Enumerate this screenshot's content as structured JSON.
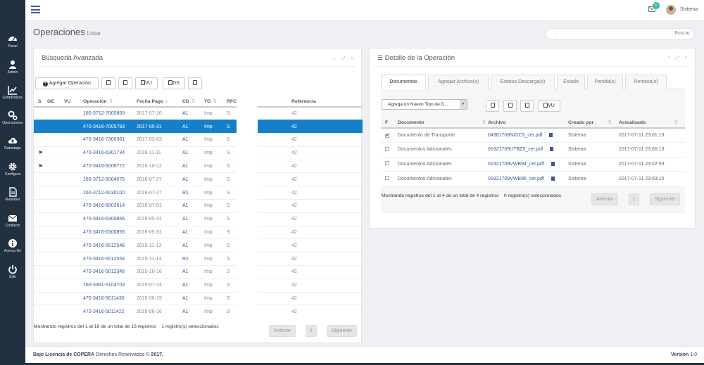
{
  "sidebar": {
    "items": [
      {
        "label": "Panel",
        "icon": "dashboard-icon"
      },
      {
        "label": "Admin",
        "icon": "users-icon"
      },
      {
        "label": "Estadísticas",
        "icon": "chart-icon"
      },
      {
        "label": "Operaciones",
        "icon": "gears-icon"
      },
      {
        "label": "Datastage",
        "icon": "cloud-upload-icon"
      },
      {
        "label": "Configura",
        "icon": "gear-icon"
      },
      {
        "label": "Reportes",
        "icon": "file-icon"
      },
      {
        "label": "Contacto",
        "icon": "envelope-icon"
      },
      {
        "label": "Acerca De",
        "icon": "info-icon"
      },
      {
        "label": "Salir",
        "icon": "power-icon"
      }
    ]
  },
  "topbar": {
    "notifications": "6",
    "user": "Sistema"
  },
  "page": {
    "title": "Operaciones",
    "subtitle": "Listar"
  },
  "search": {
    "placeholder": "...",
    "button": "Buscar"
  },
  "left_panel": {
    "title": "Búsqueda Avanzada",
    "tools": "⌄ ⤢ ×",
    "add_button": "Agregar Operación",
    "btn_vu": "VU",
    "btn_ds": "DS",
    "columns": [
      "S",
      "GE",
      "VU",
      "Operación",
      "Fecha Pago",
      "CD",
      "TO",
      "RFC",
      "Referencia"
    ],
    "rows": [
      {
        "flag": "",
        "op": "160-3712-7005669",
        "date": "2017-07-10",
        "cd": "A1",
        "to": "Imp",
        "rfc": "S",
        "ref": "42"
      },
      {
        "flag": "",
        "op": "470-3416-7005793",
        "date": "2017-05-31",
        "cd": "A1",
        "to": "Imp",
        "rfc": "S",
        "ref": "42"
      },
      {
        "flag": "",
        "op": "470-3416-7300361",
        "date": "2017-03-03",
        "cd": "A1",
        "to": "Imp",
        "rfc": "S",
        "ref": "42"
      },
      {
        "flag": "⚑",
        "op": "470-3416-6301734",
        "date": "2016-11-11",
        "cd": "A1",
        "to": "Imp",
        "rfc": "S",
        "ref": "42"
      },
      {
        "flag": "⚑",
        "op": "470-3416-6006772",
        "date": "2016-10-12",
        "cd": "A1",
        "to": "Imp",
        "rfc": "S",
        "ref": "42"
      },
      {
        "flag": "",
        "op": "160-3712-6004075",
        "date": "2016-07-27",
        "cd": "A1",
        "to": "Imp",
        "rfc": "S",
        "ref": "42"
      },
      {
        "flag": "",
        "op": "160-3712-6030100",
        "date": "2016-07-27",
        "cd": "R1",
        "to": "Imp",
        "rfc": "S",
        "ref": "42"
      },
      {
        "flag": "",
        "op": "470-3416-6003614",
        "date": "2016-07-01",
        "cd": "A1",
        "to": "Imp",
        "rfc": "S",
        "ref": "42"
      },
      {
        "flag": "",
        "op": "470-3416-6300856",
        "date": "2016-05-31",
        "cd": "A1",
        "to": "Imp",
        "rfc": "S",
        "ref": "42"
      },
      {
        "flag": "",
        "op": "470-3416-6300855",
        "date": "2016-05-31",
        "cd": "A1",
        "to": "Imp",
        "rfc": "S",
        "ref": "42"
      },
      {
        "flag": "",
        "op": "470-3416-5012548",
        "date": "2015-11-13",
        "cd": "A1",
        "to": "Imp",
        "rfc": "S",
        "ref": "42"
      },
      {
        "flag": "",
        "op": "470-3416-5012554",
        "date": "2015-11-13",
        "cd": "R1",
        "to": "Imp",
        "rfc": "S",
        "ref": "42"
      },
      {
        "flag": "",
        "op": "470-3416-5012346",
        "date": "2015-10-16",
        "cd": "A1",
        "to": "Imp",
        "rfc": "S",
        "ref": "42"
      },
      {
        "flag": "",
        "op": "160-3381-5104703",
        "date": "2015-07-24",
        "cd": "A1",
        "to": "Imp",
        "rfc": "S",
        "ref": "42"
      },
      {
        "flag": "",
        "op": "470-3416-5011430",
        "date": "2015-06-19",
        "cd": "A1",
        "to": "Imp",
        "rfc": "S",
        "ref": "42"
      },
      {
        "flag": "",
        "op": "470-3416-5011422",
        "date": "2015-06-16",
        "cd": "A1",
        "to": "Imp",
        "rfc": "S",
        "ref": "42"
      }
    ],
    "selected_row": 1,
    "info": "Mostrando registros del 1 al 16 de un total de 16 registros",
    "selected_info": "1 registro(s) seleccionados",
    "prev": "Anterior",
    "page": "1",
    "next": "Siguiente"
  },
  "right_panel": {
    "title": "Detalle de la Operación",
    "tools": "^ ⤢ ×",
    "tabs": [
      "Documentos",
      "Agregar Archivo(s)",
      "Estatus Descarga(s)",
      "Estado",
      "Partida(s)",
      "Remesa(s)"
    ],
    "active_tab": 0,
    "select_value": "Agrega un Nuevo Tipo de D...",
    "btn_vu": "VU",
    "columns": [
      "F",
      "Documento",
      "Archivo",
      "Creado por",
      "Actualizado"
    ],
    "rows": [
      {
        "checked": "✔",
        "doc": "Documento de Transporte",
        "file": "04381708NIOC5_cer.pdf",
        "by": "Sistema",
        "updated": "2017-07-11 23:01:13"
      },
      {
        "checked": "",
        "doc": "Documentos Adicionales",
        "file": "01921709UTBZ5_cer.pdf",
        "by": "Sistema",
        "updated": "2017-07-11 23:00:13"
      },
      {
        "checked": "",
        "doc": "Documentos Adicionales",
        "file": "01921709VWB94_cer.pdf",
        "by": "Sistema",
        "updated": "2017-07-11 23:02:59"
      },
      {
        "checked": "",
        "doc": "Documentos Adicionales",
        "file": "01921709VWB86_cer.pdf",
        "by": "Sistema",
        "updated": "2017-07-11 23:03:15"
      }
    ],
    "info": "Mostrando registros del 1 al 4 de un total de 4 registros",
    "selected_info": "0 registro(s) seleccionados",
    "prev": "Anterior",
    "page": "1",
    "next": "Siguiente"
  },
  "footer": {
    "license_prefix": "Bajo Licencia de",
    "company": "COPERA",
    "rights": "Derechos Reservados ©",
    "year": "2017.",
    "version_label": "Version",
    "version": "1.0"
  },
  "colors": {
    "sidebar": "#22313f",
    "accent": "#1580c9",
    "link": "#3b5998",
    "badge": "#2fbf9b"
  }
}
